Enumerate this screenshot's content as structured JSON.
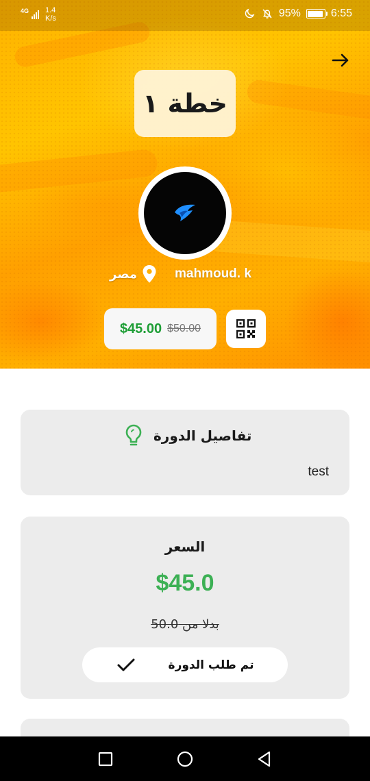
{
  "status_bar": {
    "network": "4G",
    "speed_value": "1.4",
    "speed_unit": "K/s",
    "battery": "95%",
    "time": "6:55"
  },
  "header": {
    "title": "خطة ١",
    "username": "mahmoud. k",
    "location": "مصر",
    "price_current": "$45.00",
    "price_original": "$50.00"
  },
  "details": {
    "heading": "تفاصيل الدورة",
    "body": "test"
  },
  "pricing": {
    "label": "السعر",
    "amount": "$45.0",
    "instead_of": "بدلا من 50.0",
    "ordered_label": "تم طلب الدورة"
  },
  "colors": {
    "accent_green": "#3cb054",
    "price_green": "#1e9e36",
    "hero_orange": "#ffb300",
    "card_gray": "#ececec"
  },
  "icons": [
    "back-arrow-icon",
    "location-pin-icon",
    "qr-code-icon",
    "lightbulb-icon",
    "check-icon",
    "app-logo-icon"
  ]
}
